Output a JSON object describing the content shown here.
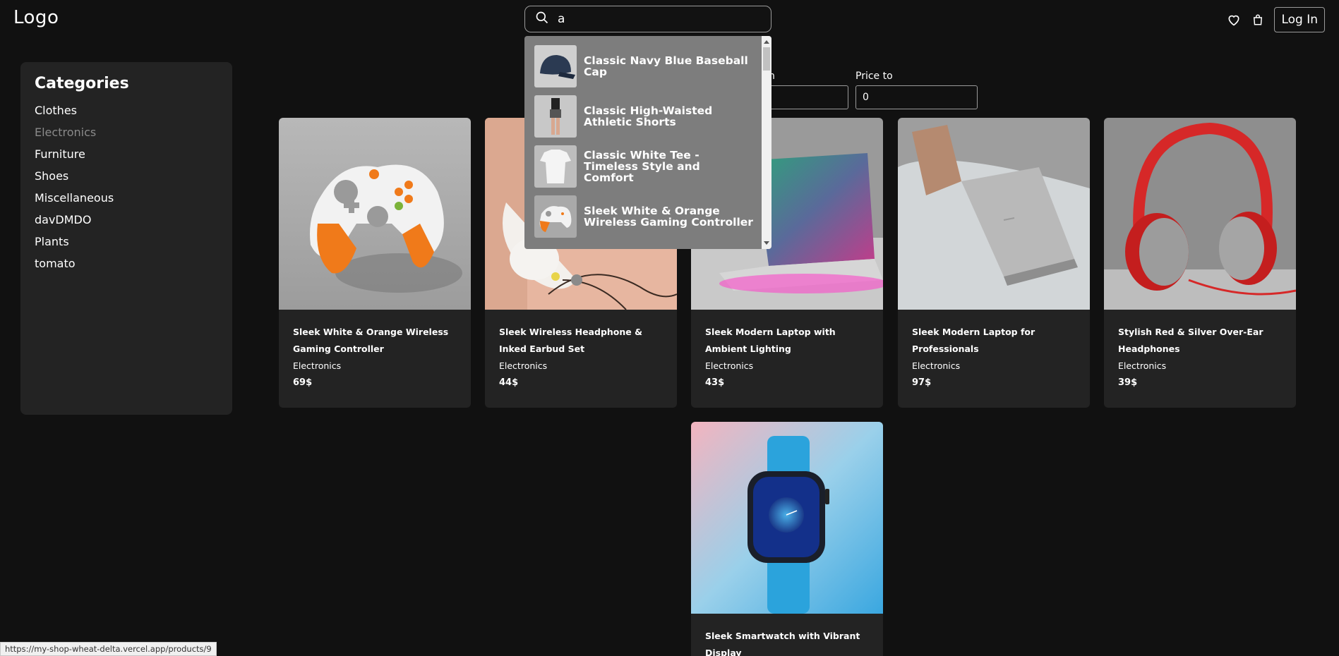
{
  "header": {
    "logo": "Logo",
    "search_value": "a",
    "login_label": "Log In"
  },
  "sidebar": {
    "title": "Categories",
    "items": [
      {
        "label": "Clothes"
      },
      {
        "label": "Electronics"
      },
      {
        "label": "Furniture"
      },
      {
        "label": "Shoes"
      },
      {
        "label": "Miscellaneous"
      },
      {
        "label": "davDMDO"
      },
      {
        "label": "Plants"
      },
      {
        "label": "tomato"
      }
    ]
  },
  "filters": {
    "price_from_label_partial": "n",
    "price_to_label": "Price to",
    "price_to_value": "0"
  },
  "search_dropdown": {
    "items": [
      {
        "label": "Classic Navy Blue Baseball Cap"
      },
      {
        "label": "Classic High-Waisted Athletic Shorts"
      },
      {
        "label": "Classic White Tee - Timeless Style and Comfort"
      },
      {
        "label": "Sleek White & Orange Wireless Gaming Controller"
      }
    ]
  },
  "products": [
    {
      "title": "Sleek White & Orange Wireless Gaming Controller",
      "category": "Electronics",
      "price": "69$"
    },
    {
      "title": "Sleek Wireless Headphone & Inked Earbud Set",
      "category": "Electronics",
      "price": "44$"
    },
    {
      "title": "Sleek Modern Laptop with Ambient Lighting",
      "category": "Electronics",
      "price": "43$"
    },
    {
      "title": "Sleek Modern Laptop for Professionals",
      "category": "Electronics",
      "price": "97$"
    },
    {
      "title": "Stylish Red & Silver Over-Ear Headphones",
      "category": "Electronics",
      "price": "39$"
    },
    {
      "title": "Sleek Smartwatch with Vibrant Display",
      "category": "",
      "price": ""
    }
  ],
  "status_url": "https://my-shop-wheat-delta.vercel.app/products/9",
  "icons": [
    "search-icon",
    "heart-icon",
    "shopping-bag-icon"
  ],
  "colors": {
    "background": "#111111",
    "panel": "#232323",
    "dropdown": "#7d7d7d"
  }
}
